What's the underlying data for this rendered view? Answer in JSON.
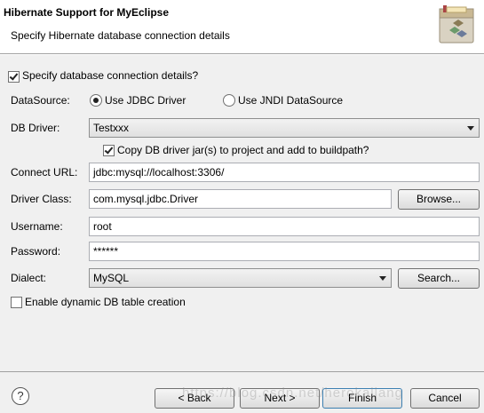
{
  "header": {
    "title": "Hibernate Support for MyEclipse",
    "subtitle": "Specify Hibernate database connection details",
    "icon": "hibernate-logo-icon"
  },
  "form": {
    "specify_label": "Specify database connection details?",
    "specify_checked": true,
    "datasource_label": "DataSource:",
    "radio_jdbc": "Use JDBC Driver",
    "radio_jndi": "Use JNDI DataSource",
    "radio_selected": "jdbc",
    "db_driver_label": "DB Driver:",
    "db_driver_value": "Testxxx",
    "copy_jar_label": "Copy DB driver jar(s) to project and add to buildpath?",
    "copy_jar_checked": true,
    "connect_url_label": "Connect URL:",
    "connect_url_value": "jdbc:mysql://localhost:3306/",
    "driver_class_label": "Driver Class:",
    "driver_class_value": "com.mysql.jdbc.Driver",
    "browse_button": "Browse...",
    "username_label": "Username:",
    "username_value": "root",
    "password_label": "Password:",
    "password_value": "******",
    "dialect_label": "Dialect:",
    "dialect_value": "MySQL",
    "search_button": "Search...",
    "enable_dynamic_label": "Enable dynamic DB table creation",
    "enable_dynamic_checked": false
  },
  "footer": {
    "help": "?",
    "back_button": "< Back",
    "next_button": "Next >",
    "finish_button": "Finish",
    "cancel_button": "Cancel",
    "watermark": "https://blog.csdn.net/herokallang"
  }
}
